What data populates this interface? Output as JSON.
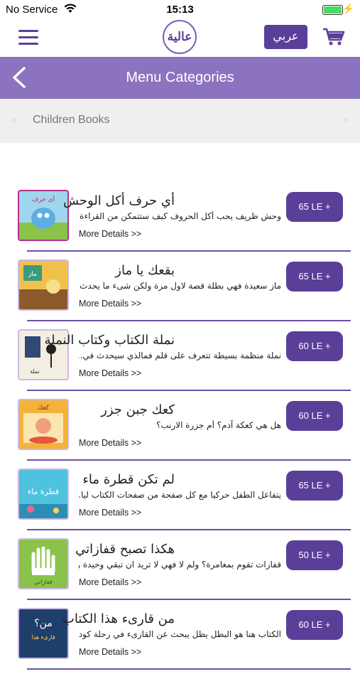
{
  "status": {
    "carrier": "No Service",
    "time": "15:13"
  },
  "header": {
    "logo_text": "عالية",
    "language_button": "عربي",
    "accent_color": "#5a3f99",
    "menu_icon": "hamburger-icon",
    "cart_icon": "cart-icon"
  },
  "title_bar": {
    "title": "Menu Categories",
    "back_icon": "chevron-left-icon",
    "color": "#8c73bf"
  },
  "category": {
    "label": "Children Books",
    "prev": "<",
    "next": ">"
  },
  "books": [
    {
      "title": "أي حرف أكل الوحش",
      "description": "وحش ظريف يحب أكل الحروف كيف ستتمكن من القراءة إ...",
      "more": "More Details >>",
      "price": "65 LE +"
    },
    {
      "title": "بقعك يا ماز",
      "description": "ماز سعيدة فهي بطلة قصة لاول مرة ولكن شىء ما يحدث...",
      "more": "More Details >>",
      "price": "65 LE +"
    },
    {
      "title": "نملة الكتاب وكتاب النملة",
      "description": "نملة منظمة بسيطة تتعرف على قلم فمالذي سيحدث في...",
      "more": "More Details >>",
      "price": "60 LE +"
    },
    {
      "title": "كعك جبن جزر",
      "description": "هل هي كعكة آدم؟ أم جزرة الارنب؟",
      "more": "More Details >>",
      "price": "60 LE +"
    },
    {
      "title": "لم تكن قطرة ماء",
      "description": "يتفاعل الطفل حركيا مع كل صفحة من صفحات الكتاب ليا...",
      "more": "More Details >>",
      "price": "65 LE +"
    },
    {
      "title": "هكذا تصبح قفازاتي",
      "description": "قفازات تقوم بمغامرة؟ ولم لا فهي لا تريد ان تبقي وحيدة و...",
      "more": "More Details >>",
      "price": "50 LE +"
    },
    {
      "title": "من قارىء هذا الكتاب",
      "description": "الكتاب هنا هو البطل يظل يبحث عن القارىء في رحلة كود...",
      "more": "More Details >>",
      "price": "60 LE +"
    }
  ]
}
